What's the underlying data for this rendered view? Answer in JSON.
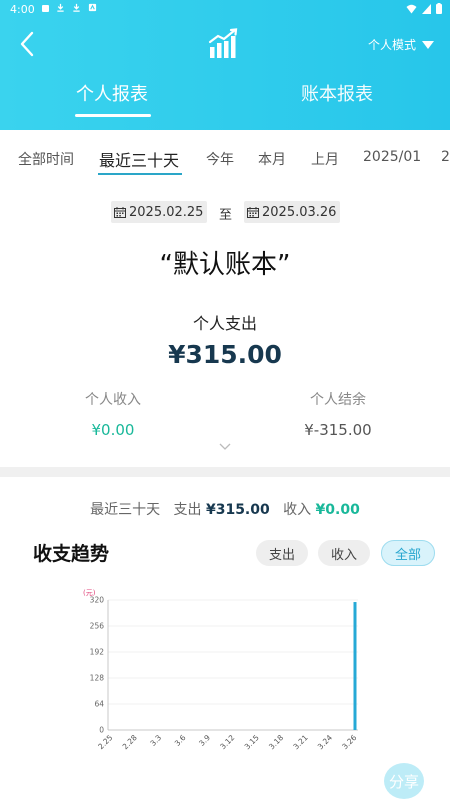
{
  "status_bar": {
    "time": "4:00"
  },
  "header": {
    "mode_label": "个人模式",
    "tabs": [
      {
        "label": "个人报表",
        "active": true
      },
      {
        "label": "账本报表",
        "active": false
      }
    ]
  },
  "periods": [
    "全部时间",
    "最近三十天",
    "今年",
    "本月",
    "上月",
    "2025/01",
    "2"
  ],
  "active_period": "最近三十天",
  "date_range": {
    "start": "2025.02.25",
    "separator": "至",
    "end": "2025.03.26"
  },
  "book_name": "“默认账本”",
  "expense": {
    "label": "个人支出",
    "value": "¥315.00"
  },
  "income": {
    "label": "个人收入",
    "value": "¥0.00"
  },
  "balance": {
    "label": "个人结余",
    "value": "¥-315.00"
  },
  "summary": {
    "period": "最近三十天",
    "expense_label": "支出",
    "expense_value": "¥315.00",
    "income_label": "收入",
    "income_value": "¥0.00"
  },
  "trend": {
    "title": "收支趋势",
    "filters": [
      "支出",
      "收入",
      "全部"
    ],
    "active_filter": "全部"
  },
  "chart_data": {
    "type": "bar",
    "y_unit_label": "(元)",
    "ylim": [
      0,
      320
    ],
    "y_ticks": [
      0,
      64,
      128,
      192,
      256,
      320
    ],
    "x_ticks": [
      "2.25",
      "2.28",
      "3.3",
      "3.6",
      "3.9",
      "3.12",
      "3.15",
      "3.18",
      "3.21",
      "3.24",
      "3.26"
    ],
    "series": [
      {
        "values": [
          0,
          0,
          0,
          0,
          0,
          0,
          0,
          0,
          0,
          0,
          315
        ]
      }
    ],
    "bar_color": "#26a9d6",
    "grid": true
  },
  "share_label": "分享",
  "colors": {
    "accent": "#27c6ea",
    "green": "#19b89a",
    "navy": "#17384f"
  }
}
